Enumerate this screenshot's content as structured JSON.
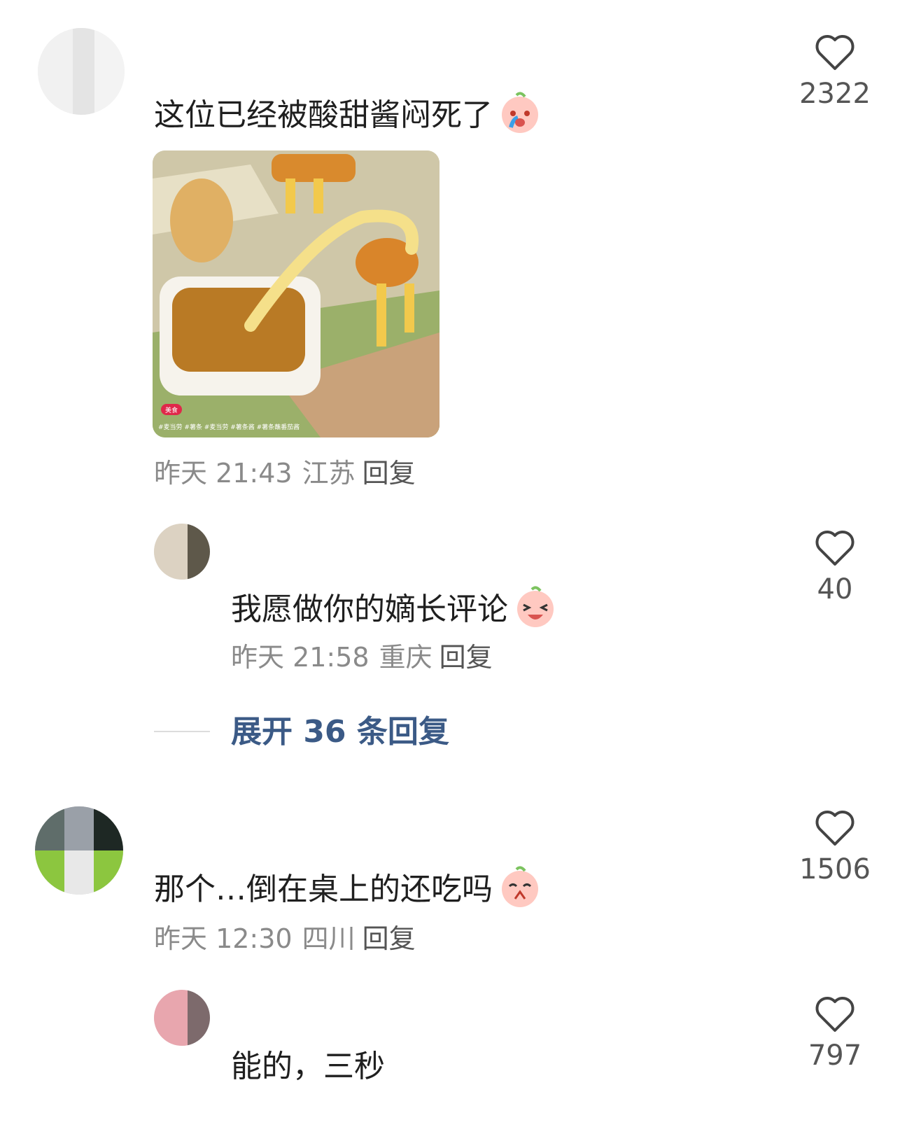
{
  "comments": [
    {
      "text": "这位已经被酸甜酱闷死了",
      "emoji": "crying-face-emoji",
      "time": "昨天 21:43",
      "location": "江苏",
      "reply_label": "回复",
      "likes": "2322",
      "image_sticker_text": "美食",
      "image_caption": "#麦当劳 #薯条 #麦当劳 #薯条酱 #薯条蘸番茄酱"
    },
    {
      "text": "我愿做你的嫡长评论",
      "emoji": "laughing-face-emoji",
      "time": "昨天 21:58",
      "location": "重庆",
      "reply_label": "回复",
      "likes": "40"
    },
    {
      "text": "那个…倒在桌上的还吃吗",
      "emoji": "praying-face-emoji",
      "time": "昨天 12:30",
      "location": "四川",
      "reply_label": "回复",
      "likes": "1506"
    },
    {
      "text": "能的，三秒",
      "likes": "797"
    }
  ],
  "expand_replies": "展开 36 条回复",
  "colors": {
    "accent": "#3b5a86",
    "meta": "#8a8a8a"
  }
}
